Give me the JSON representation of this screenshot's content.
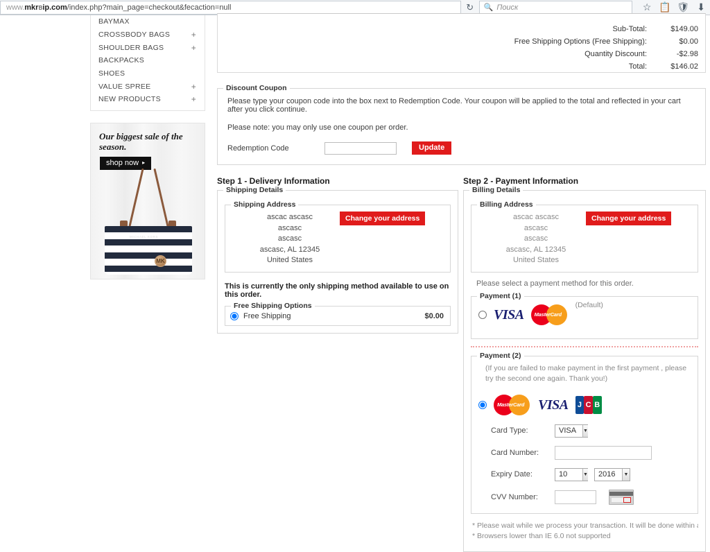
{
  "browser": {
    "url_prefix": "www.",
    "url_host_bold": "mkr",
    "url_host_mid": "в",
    "url_host_bold2": "ip.com",
    "url_path": "/index.php?main_page=checkout&fecaction=null",
    "reload_icon": "reload-icon",
    "search_placeholder": "Поиск",
    "search_icon": "search-icon",
    "bookmark_icon": "star-icon",
    "reading_list_icon": "clipboard-icon",
    "shield_icon": "shield-icon",
    "downloads_icon": "download-arrow-icon"
  },
  "sidebar": {
    "categories": [
      {
        "label": "BAYMAX",
        "expandable": false,
        "plus": ""
      },
      {
        "label": "CROSSBODY BAGS",
        "expandable": true,
        "plus": "+"
      },
      {
        "label": "SHOULDER BAGS",
        "expandable": true,
        "plus": "+"
      },
      {
        "label": "BACKPACKS",
        "expandable": false,
        "plus": ""
      },
      {
        "label": "SHOES",
        "expandable": false,
        "plus": ""
      },
      {
        "label": "VALUE SPREE",
        "expandable": true,
        "plus": "+"
      },
      {
        "label": "NEW PRODUCTS",
        "expandable": true,
        "plus": "+"
      }
    ],
    "promo": {
      "headline": "Our biggest sale of the season.",
      "cta_label": "shop now",
      "cta_arrow": "▸",
      "bag_brand": "MICHAEL KORS",
      "charm_text": "MK"
    }
  },
  "order_totals": [
    {
      "label": "Sub-Total:",
      "value": "$149.00"
    },
    {
      "label": "Free Shipping Options (Free Shipping):",
      "value": "$0.00"
    },
    {
      "label": "Quantity Discount:",
      "value": "-$2.98"
    },
    {
      "label": "Total:",
      "value": "$146.02"
    }
  ],
  "coupon": {
    "legend": "Discount Coupon",
    "line1": "Please type your coupon code into the box next to Redemption Code. Your coupon will be applied to the total and reflected in your cart after you click continue.",
    "line2": "Please note: you may only use one coupon per order.",
    "field_label": "Redemption Code",
    "input_value": "",
    "input_placeholder": "",
    "update_label": "Update"
  },
  "step1": {
    "title": "Step 1 - Delivery Information",
    "details_legend": "Shipping Details",
    "address_legend": "Shipping Address",
    "address_lines": [
      "ascac ascasc",
      "ascasc",
      "ascasc",
      "ascasc, AL 12345",
      "United States"
    ],
    "change_address_label": "Change your address",
    "shipping_note": "This is currently the only shipping method available to use on this order.",
    "shipping_options_legend": "Free Shipping Options",
    "shipping_option": {
      "name": "Free Shipping",
      "price": "$0.00",
      "selected": true
    }
  },
  "step2": {
    "title": "Step 2 - Payment Information",
    "details_legend": "Billing Details",
    "address_legend": "Billing Address",
    "address_lines": [
      "ascac ascasc",
      "ascasc",
      "ascasc",
      "ascasc, AL 12345",
      "United States"
    ],
    "change_address_label": "Change your address",
    "select_method_text": "Please select a payment method for this order.",
    "payment1": {
      "legend": "Payment (1)",
      "default_label": "(Default)",
      "selected": false,
      "logos": [
        "visa-logo",
        "mastercard-logo"
      ]
    },
    "payment2": {
      "legend": "Payment (2)",
      "note": "(If you are failed to make payment in the first payment , please try the second one again. Thank you!)",
      "selected": true,
      "logos": [
        "mastercard-logo",
        "visa-logo",
        "jcb-logo"
      ],
      "fields": {
        "card_type_label": "Card Type:",
        "card_type_value": "VISA",
        "card_number_label": "Card Number:",
        "card_number_value": "",
        "expiry_label": "Expiry Date:",
        "expiry_month": "10",
        "expiry_year": "2016",
        "cvv_label": "CVV Number:",
        "cvv_value": ""
      }
    },
    "footnotes": [
      "* Please wait while we process your transaction. It will be done within a moment....",
      "* Browsers lower than IE 6.0 not supported"
    ]
  },
  "logos": {
    "visa_text": "VISA",
    "mastercard_text": "MasterCard",
    "jcb_j": "J",
    "jcb_c": "C",
    "jcb_b": "B"
  },
  "colors": {
    "accent_red": "#e01b1b",
    "visa_blue": "#1a1f71",
    "mc_red": "#eb001b",
    "mc_orange": "#f79e1b"
  }
}
